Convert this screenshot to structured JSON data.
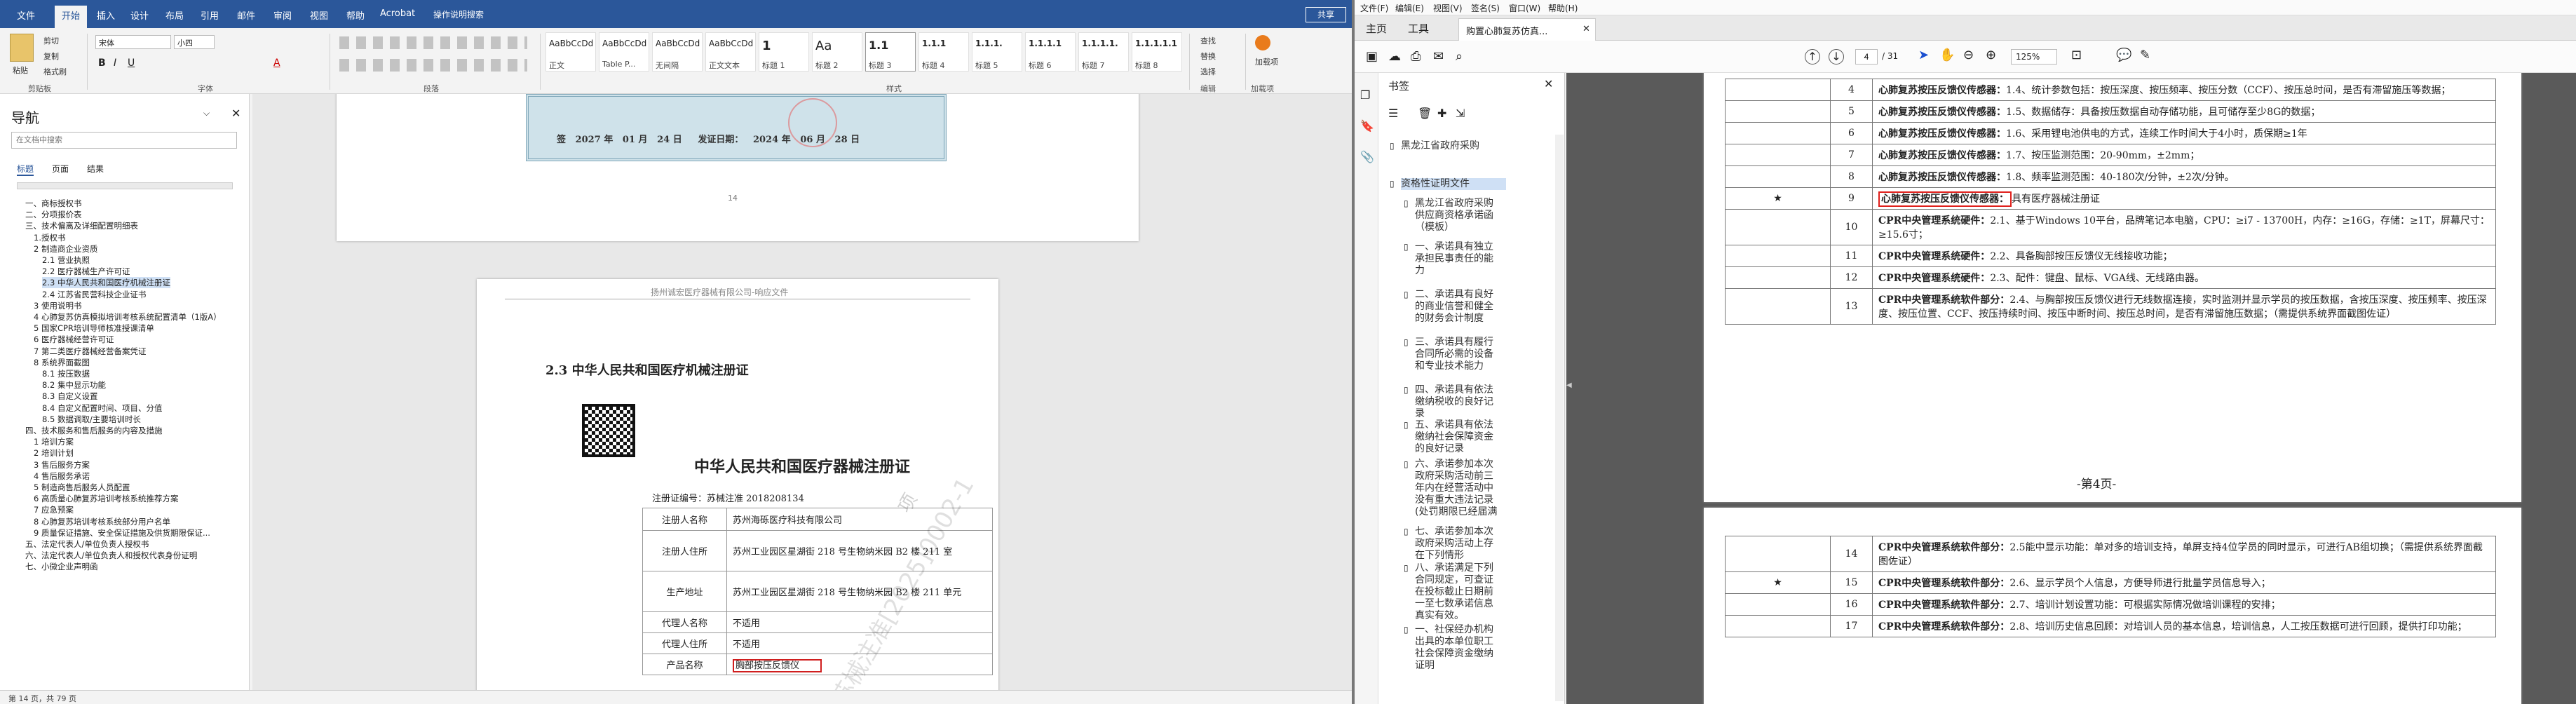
{
  "word": {
    "tabs": [
      "文件",
      "开始",
      "插入",
      "设计",
      "布局",
      "引用",
      "邮件",
      "审阅",
      "视图",
      "帮助",
      "Acrobat",
      "操作说明搜索"
    ],
    "share": "共享",
    "clipboard": {
      "paste": "粘贴",
      "cut": "剪切",
      "copy": "复制",
      "format_painter": "格式刷",
      "label": "剪贴板"
    },
    "font": {
      "name": "宋体",
      "size": "小四",
      "label": "字体"
    },
    "paragraph_label": "段落",
    "styles_label": "样式",
    "styles": [
      {
        "sample": "AaBbCcDd",
        "name": "正文"
      },
      {
        "sample": "AaBbCcDd",
        "name": "Table P..."
      },
      {
        "sample": "AaBbCcDd",
        "name": "无间隔"
      },
      {
        "sample": "AaBbCcDd",
        "name": "正文文本"
      },
      {
        "sample": "1",
        "name": "标题 1"
      },
      {
        "sample": "Aa",
        "name": "标题 2"
      },
      {
        "sample": "1.1",
        "name": "标题 3"
      },
      {
        "sample": "1.1.1",
        "name": "标题 4"
      },
      {
        "sample": "1.1.1.",
        "name": "标题 5"
      },
      {
        "sample": "1.1.1.1",
        "name": "标题 6"
      },
      {
        "sample": "1.1.1.1.",
        "name": "标题 7"
      },
      {
        "sample": "1.1.1.1.1",
        "name": "标题 8"
      }
    ],
    "editing": {
      "find": "查找",
      "replace": "替换",
      "select": "选择",
      "label": "编辑"
    },
    "addin": {
      "label": "加载项",
      "sub": "加载项"
    },
    "nav": {
      "title": "导航",
      "search_placeholder": "在文档中搜索",
      "tabs": [
        "标题",
        "页面",
        "结果"
      ],
      "items": [
        "一、商标授权书",
        "二、分项报价表",
        "三、技术偏离及详细配置明细表",
        "1.授权书",
        "2 制造商企业资质",
        "2.1 营业执照",
        "2.2 医疗器械生产许可证",
        "2.3 中华人民共和国医疗机械注册证",
        "2.4 江苏省民营科技企业证书",
        "3 使用说明书",
        "4 心肺复苏仿真模拟培训考核系统配置清单（1版A）",
        "5 国家CPR培训导师核准授课清单",
        "6 医疗器械经营许可证",
        "7 第二类医疗器械经营备案凭证",
        "8 系统界面截图",
        "8.1 按压数据",
        "8.2 集中显示功能",
        "8.3 自定义设置",
        "8.4 自定义配置时间、项目、分值",
        "8.5 数据调取/主要培训时长",
        "四、技术服务和售后服务的内容及措施",
        "1 培训方案",
        "2 培训计划",
        "3 售后服务方案",
        "4 售后服务承诺",
        "5 制造商售后服务人员配置",
        "6 高质量心肺复苏培训考核系统推荐方案",
        "7 应急预案",
        "8 心肺复苏培训考核系统部分用户名单",
        "9 质量保证措施、安全保证措施及供货期限保证...",
        "五、法定代表人/单位负责人授权书",
        "六、法定代表人/单位负责人和授权代表身份证明",
        "七、小微企业声明函"
      ]
    },
    "doc": {
      "cert_top": {
        "left": "签",
        "year1": "2027",
        "m1": "年",
        "mon1": "01",
        "mo1": "月",
        "d1": "24",
        "day1": "日",
        "issue": "发证日期：",
        "year2": "2024",
        "y2": "年",
        "mon2": "06",
        "mo2": "月",
        "d2": "28",
        "dy2": "日"
      },
      "page_num": "14",
      "header": "扬州诚宏医疗器械有限公司-响应文件",
      "heading": "2.3  中华人民共和国医疗机械注册证",
      "cert_title": "中华人民共和国医疗器械注册证",
      "reg_no_label": "注册证编号：苏械注准 2018208134",
      "rows": [
        {
          "k": "注册人名称",
          "v": "苏州海砾医疗科技有限公司"
        },
        {
          "k": "注册人住所",
          "v": "苏州工业园区星湖街 218 号生物纳米园 B2 楼 211 室"
        },
        {
          "k": "生产地址",
          "v": "苏州工业园区星湖街 218 号生物纳米园 B2 楼 211 单元"
        },
        {
          "k": "代理人名称",
          "v": "不适用"
        },
        {
          "k": "代理人住所",
          "v": "不适用"
        },
        {
          "k": "产品名称",
          "v": "胸部按压反馈仪"
        }
      ],
      "watermarks": [
        "苏械注准[2025]0002-1",
        "项"
      ]
    },
    "status": "第 14 页，共 79 页"
  },
  "pdf": {
    "menu": [
      "文件(F)",
      "编辑(E)",
      "视图(V)",
      "签名(S)",
      "窗口(W)",
      "帮助(H)"
    ],
    "tabs": [
      "主页",
      "工具"
    ],
    "doc_tab": "购置心肺复苏仿真...",
    "page_current": "4",
    "page_total": "/ 31",
    "zoom": "125%",
    "bookmarks_title": "书签",
    "bookmarks": [
      "黑龙江省政府采购",
      "资格性证明文件",
      "黑龙江省政府采购供应商资格承诺函（模板）",
      "一、承诺具有独立承担民事责任的能力",
      "二、承诺具有良好的商业信誉和健全的财务会计制度",
      "三、承诺具有履行合同所必需的设备和专业技术能力",
      "四、承诺具有依法缴纳税收的良好记录",
      "五、承诺具有依法缴纳社会保障资金的良好记录",
      "六、承诺参加本次政府采购活动前三年内在经营活动中没有重大违法记录(处罚期限已经届满",
      "七、承诺参加本次政府采购活动上存在下列情形",
      "八、承诺满足下列合同规定，可查证在投标截止日期前一至七数承诺信息真实有效。",
      "一、社保经办机构出具的本单位职工社会保障资金缴纳证明"
    ],
    "rows_a": [
      {
        "n": "4",
        "star": "",
        "h": "心肺复苏按压反馈仪传感器：",
        "t": "1.4、统计参数包括：按压深度、按压频率、按压分数（CCF）、按压总时间，是否有滞留施压等数据；"
      },
      {
        "n": "5",
        "star": "",
        "h": "心肺复苏按压反馈仪传感器：",
        "t": "1.5、数据储存：具备按压数据自动存储功能，且可储存至少8G的数据；"
      },
      {
        "n": "6",
        "star": "",
        "h": "心肺复苏按压反馈仪传感器：",
        "t": "1.6、采用锂电池供电的方式，连续工作时间大于4小时，质保期≥1年"
      },
      {
        "n": "7",
        "star": "",
        "h": "心肺复苏按压反馈仪传感器：",
        "t": "1.7、按压监测范围：20-90mm，±2mm；"
      },
      {
        "n": "8",
        "star": "",
        "h": "心肺复苏按压反馈仪传感器：",
        "t": "1.8、频率监测范围：40-180次/分钟，±2次/分钟。"
      },
      {
        "n": "9",
        "star": "★",
        "h": "心肺复苏按压反馈仪传感器：",
        "t": "具有医疗器械注册证"
      },
      {
        "n": "10",
        "star": "",
        "h": "CPR中央管理系统硬件：",
        "t": "2.1、基于Windows 10平台，品牌笔记本电脑，CPU：≥i7 - 13700H，内存：≥16G，存储：≥1T，屏幕尺寸：≥15.6寸；"
      },
      {
        "n": "11",
        "star": "",
        "h": "CPR中央管理系统硬件：",
        "t": "2.2、具备胸部按压反馈仪无线接收功能；"
      },
      {
        "n": "12",
        "star": "",
        "h": "CPR中央管理系统硬件：",
        "t": "2.3、配件：键盘、鼠标、VGA线、无线路由器。"
      },
      {
        "n": "13",
        "star": "",
        "h": "CPR中央管理系统软件部分：",
        "t": "2.4、与胸部按压反馈仪进行无线数据连接，实时监测并显示学员的按压数据，含按压深度、按压频率、按压深度、按压位置、CCF、按压持续时间、按压中断时间、按压总时间，是否有滞留施压数据；（需提供系统界面截图佐证）"
      }
    ],
    "page_label": "-第4页-",
    "rows_b": [
      {
        "n": "14",
        "star": "",
        "h": "CPR中央管理系统软件部分：",
        "t": "2.5能中显示功能：单对多的培训支持，单屏支持4位学员的同时显示，可进行AB组切换；（需提供系统界面截图佐证）"
      },
      {
        "n": "15",
        "star": "★",
        "h": "CPR中央管理系统软件部分：",
        "t": "2.6、显示学员个人信息，方便导师进行批量学员信息导入；"
      },
      {
        "n": "16",
        "star": "",
        "h": "CPR中央管理系统软件部分：",
        "t": "2.7、培训计划设置功能：可根据实际情况做培训课程的安排；"
      },
      {
        "n": "17",
        "star": "",
        "h": "CPR中央管理系统软件部分：",
        "t": "2.8、培训历史信息回顾：对培训人员的基本信息，培训信息，人工按压数据可进行回顾，提供打印功能；"
      }
    ]
  }
}
